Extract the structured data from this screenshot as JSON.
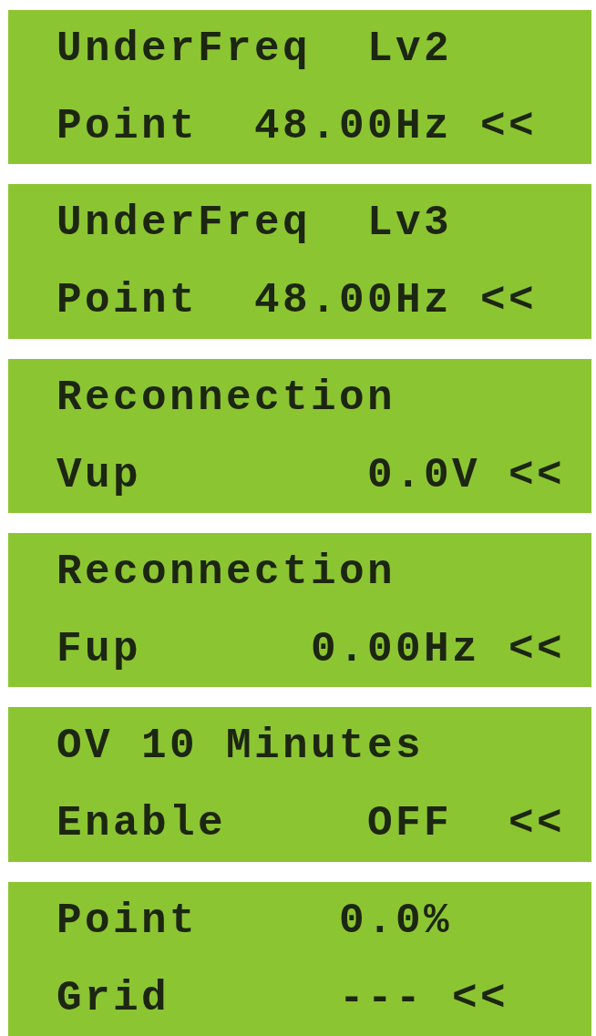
{
  "screens": [
    {
      "lines": [
        "UnderFreq  Lv2",
        "Point  48.00Hz <<"
      ]
    },
    {
      "lines": [
        "UnderFreq  Lv3",
        "Point  48.00Hz <<"
      ]
    },
    {
      "lines": [
        "Reconnection",
        "Vup        0.0V <<"
      ]
    },
    {
      "lines": [
        "Reconnection",
        "Fup      0.00Hz <<"
      ]
    },
    {
      "lines": [
        "OV 10 Minutes",
        "Enable     OFF  <<"
      ]
    },
    {
      "lines": [
        "Point     0.0%",
        "Grid      --- <<"
      ]
    }
  ]
}
